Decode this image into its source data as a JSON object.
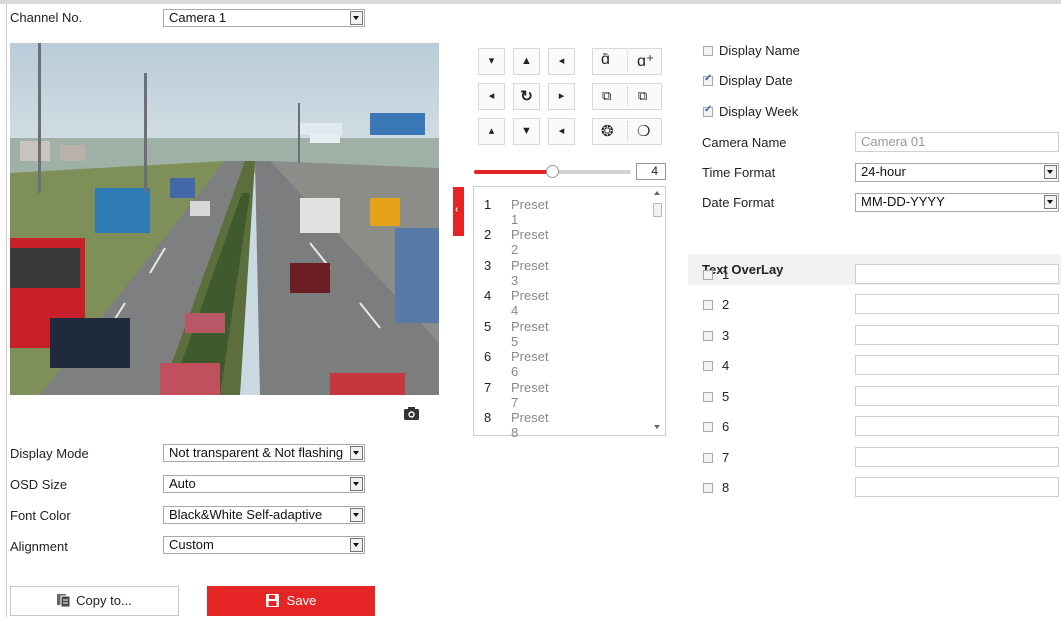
{
  "channel": {
    "label": "Channel No.",
    "value": "Camera 1"
  },
  "osd_settings": {
    "display_mode": {
      "label": "Display Mode",
      "value": "Not transparent & Not flashing"
    },
    "osd_size": {
      "label": "OSD Size",
      "value": "Auto"
    },
    "font_color": {
      "label": "Font Color",
      "value": "Black&White Self-adaptive"
    },
    "alignment": {
      "label": "Alignment",
      "value": "Custom"
    }
  },
  "ptz": {
    "zoom_step_value": "4",
    "zoom_level_percent": 50
  },
  "presets": [
    {
      "num": "1",
      "name": "Preset 1"
    },
    {
      "num": "2",
      "name": "Preset 2"
    },
    {
      "num": "3",
      "name": "Preset 3"
    },
    {
      "num": "4",
      "name": "Preset 4"
    },
    {
      "num": "5",
      "name": "Preset 5"
    },
    {
      "num": "6",
      "name": "Preset 6"
    },
    {
      "num": "7",
      "name": "Preset 7"
    },
    {
      "num": "8",
      "name": "Preset 8"
    }
  ],
  "display": {
    "display_name": {
      "label": "Display Name",
      "checked": false
    },
    "display_date": {
      "label": "Display Date",
      "checked": true
    },
    "display_week": {
      "label": "Display Week",
      "checked": true
    },
    "camera_name": {
      "label": "Camera Name",
      "value": "Camera 01"
    },
    "time_format": {
      "label": "Time Format",
      "value": "24-hour"
    },
    "date_format": {
      "label": "Date Format",
      "value": "MM-DD-YYYY"
    }
  },
  "text_overlay": {
    "title": "Text OverLay",
    "items": [
      {
        "num": "1",
        "checked": false,
        "value": ""
      },
      {
        "num": "2",
        "checked": false,
        "value": ""
      },
      {
        "num": "3",
        "checked": false,
        "value": ""
      },
      {
        "num": "4",
        "checked": false,
        "value": ""
      },
      {
        "num": "5",
        "checked": false,
        "value": ""
      },
      {
        "num": "6",
        "checked": false,
        "value": ""
      },
      {
        "num": "7",
        "checked": false,
        "value": ""
      },
      {
        "num": "8",
        "checked": false,
        "value": ""
      }
    ]
  },
  "buttons": {
    "copy": "Copy to...",
    "save": "Save"
  },
  "colors": {
    "accent": "#e52425",
    "checked": "#2d5fa8",
    "border": "#cfcfcf"
  },
  "icons": {
    "snapshot": "camera-icon",
    "copy": "copy-icon",
    "save": "floppy-disk-icon"
  }
}
